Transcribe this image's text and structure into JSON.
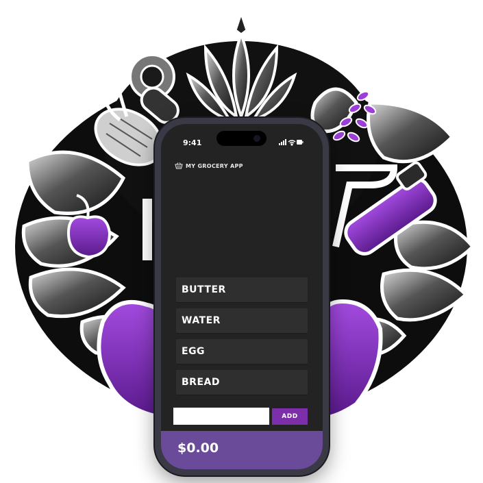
{
  "status_bar": {
    "time": "9:41"
  },
  "app": {
    "title": "MY GROCERY APP"
  },
  "grocery_list": [
    {
      "name": "BUTTER"
    },
    {
      "name": "WATER"
    },
    {
      "name": "EGG"
    },
    {
      "name": "BREAD"
    }
  ],
  "add_form": {
    "input_value": "",
    "button_label": "ADD"
  },
  "footer": {
    "total": "$0.00"
  },
  "colors": {
    "accent": "#7c2fa9",
    "footer": "#6a4b9a",
    "screen_bg": "#232323",
    "item_bg": "#2f2f2f"
  },
  "icons": [
    "basket-icon",
    "signal-icon",
    "wifi-icon",
    "battery-icon"
  ]
}
